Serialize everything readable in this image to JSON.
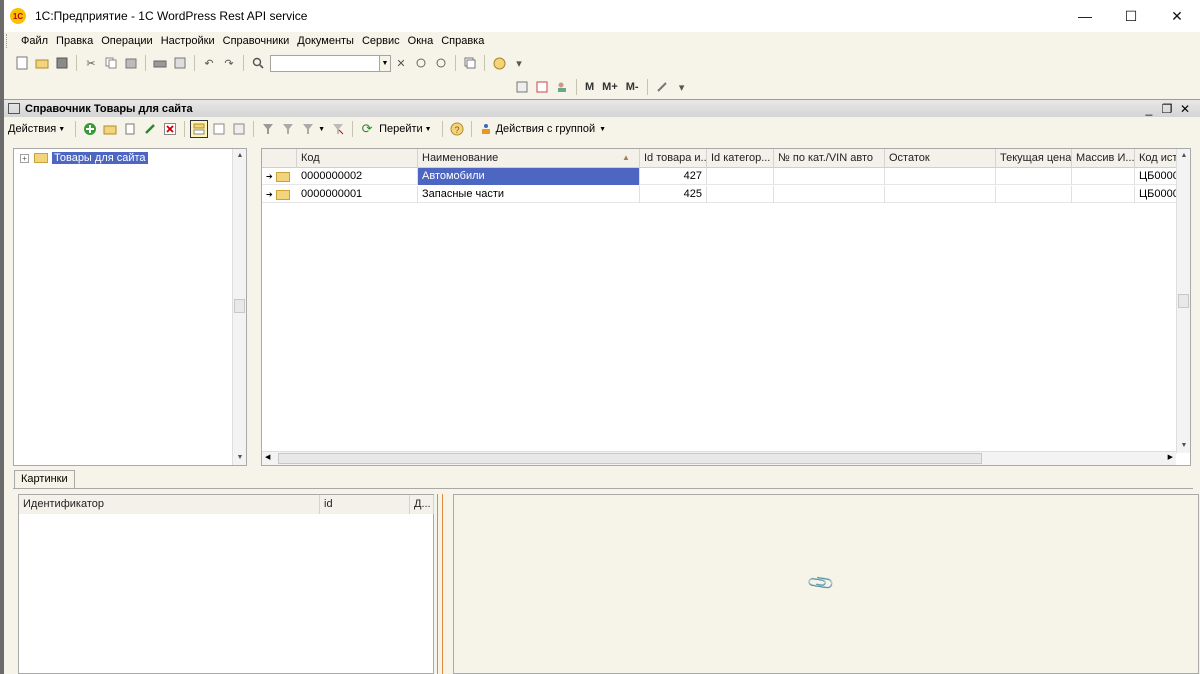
{
  "window": {
    "title": "1С:Предприятие - 1C WordPress Rest API service",
    "logo_text": "1С",
    "minimize": "—",
    "maximize": "☐",
    "close": "✕"
  },
  "menu": [
    {
      "label": "Файл"
    },
    {
      "label": "Правка"
    },
    {
      "label": "Операции"
    },
    {
      "label": "Настройки"
    },
    {
      "label": "Справочники"
    },
    {
      "label": "Документы"
    },
    {
      "label": "Сервис"
    },
    {
      "label": "Окна"
    },
    {
      "label": "Справка"
    }
  ],
  "toolbar": {
    "search_value": "",
    "calc_buttons": [
      "M",
      "M+",
      "M-"
    ]
  },
  "catalog": {
    "title": "Справочник Товары для сайта",
    "actions_label": "Действия",
    "goto_label": "Перейти",
    "group_actions_label": "Действия с группой",
    "tree_root": "Товары для сайта",
    "columns": [
      "Код",
      "Наименование",
      "Id товара и...",
      "Id категор...",
      "№ по кат./VIN авто",
      "Остаток",
      "Текущая цена",
      "Массив И...",
      "Код исто"
    ],
    "rows": [
      {
        "code": "0000000002",
        "name": "Автомобили",
        "id": "427",
        "src": "ЦБ0000"
      },
      {
        "code": "0000000001",
        "name": "Запасные части",
        "id": "425",
        "src": "ЦБ0000"
      }
    ]
  },
  "pictures": {
    "tab_label": "Картинки",
    "columns": [
      "Идентификатор",
      "id",
      "Д..."
    ]
  },
  "colors": {
    "selection": "#4c66c1",
    "background": "#f6f3e8",
    "splitter": "#e38a3a"
  }
}
